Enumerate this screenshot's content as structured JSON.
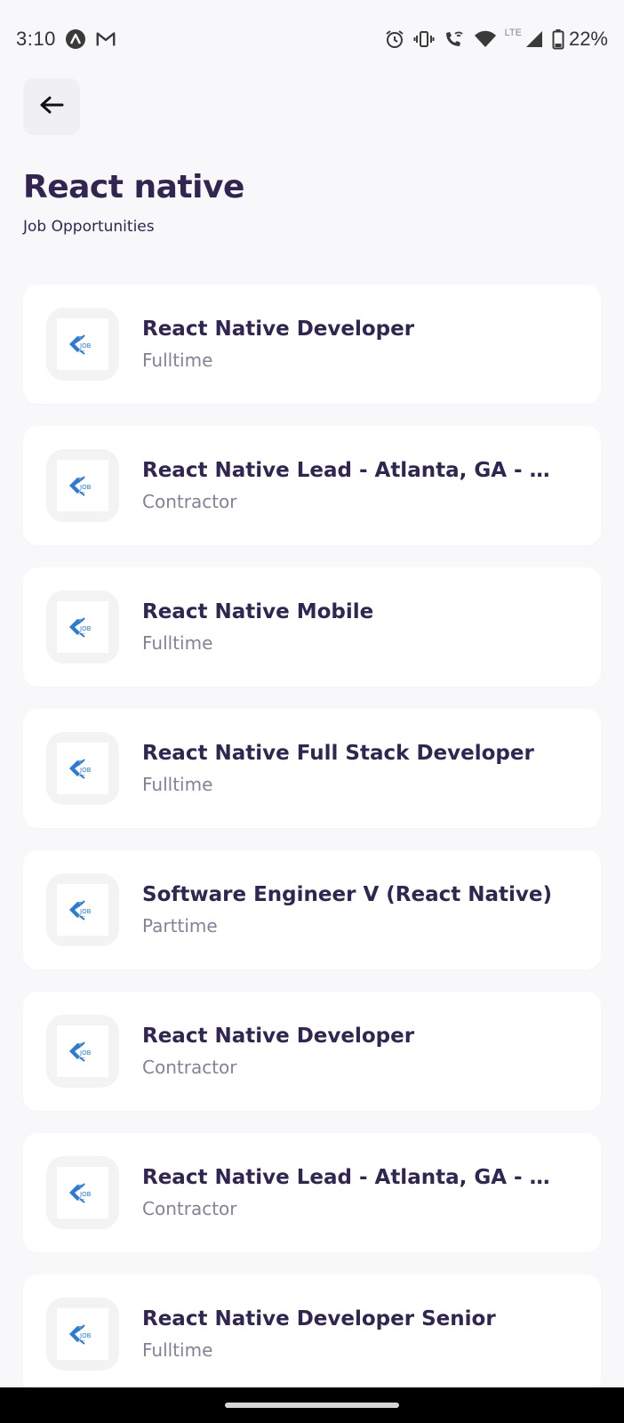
{
  "status_bar": {
    "time": "3:10",
    "lte_label": "LTE",
    "battery": "22%"
  },
  "header": {
    "title": "React native",
    "subtitle": "Job Opportunities"
  },
  "jobs": [
    {
      "title": "React Native Developer",
      "type": "Fulltime"
    },
    {
      "title": "React Native Lead - Atlanta, GA - C...",
      "type": "Contractor"
    },
    {
      "title": "React Native Mobile",
      "type": "Fulltime"
    },
    {
      "title": "React Native Full Stack Developer",
      "type": "Fulltime"
    },
    {
      "title": "Software Engineer V (React Native)",
      "type": "Parttime"
    },
    {
      "title": "React Native Developer",
      "type": "Contractor"
    },
    {
      "title": "React Native Lead - Atlanta, GA - C...",
      "type": "Contractor"
    },
    {
      "title": "React Native Developer Senior",
      "type": "Fulltime"
    }
  ],
  "icons": {
    "back": "arrow-left-icon",
    "job_logo": "job-logo-icon"
  },
  "colors": {
    "primary_text": "#312651",
    "secondary_text": "#83829A",
    "background": "#F8F8FB",
    "logo_blue": "#2A7BD5"
  }
}
